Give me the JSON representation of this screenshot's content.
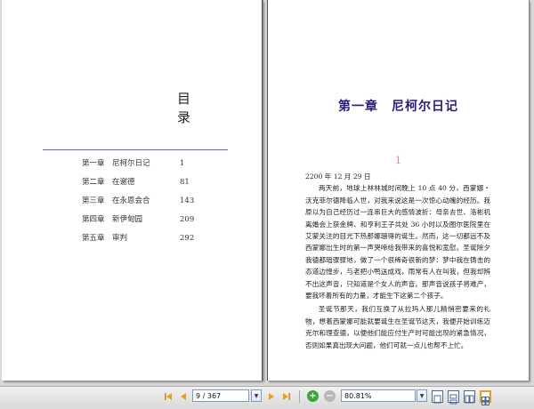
{
  "toc": {
    "title": "目 录",
    "items": [
      {
        "chapter": "第一章",
        "name": "尼柯尔日记",
        "page": "1"
      },
      {
        "chapter": "第二章",
        "name": "在谢德",
        "page": "81"
      },
      {
        "chapter": "第三章",
        "name": "在永恩会合",
        "page": "143"
      },
      {
        "chapter": "第四章",
        "name": "新伊甸园",
        "page": "209"
      },
      {
        "chapter": "第五章",
        "name": "审判",
        "page": "292"
      }
    ]
  },
  "chapter": {
    "heading": "第一章　尼柯尔日记",
    "number": "1",
    "date": "2200 年 12 月 29 日",
    "paragraphs": [
      "两天前，地球上林林城时间晚上 10 点 40 分，西蒙娜・沃克菲尔德降临人世，对我来说这是一次惊心动魄的经历。我原以为自己经历过一连串巨大的感情波折：母亲去世、洛彬机离婚会上获金牌、和亨利王子共处 36 小时以及图尔医院里在艾蒙关注的目光下热那娜珊得的诞生。然而，这一切都远不及西蒙娜出生时的第一声哭啼给我带来的喜悦和宽慰。圣诞除夕我德都暗骤骤地，做了一个很稀奇很新的梦：梦中我在铸击的态道边惶步，与老把小鸭送成戏，雨常有人在叫我，但我却辨不出这声音，只知道是个女人的声音。那声音说孩子将难产，要我坏着所有的力量，才能生下这第二个孩子。",
      "圣诞节那天，我们互换了从拉玛人那儿精悄密要来的礼物，想着西蒙娜可能就要诞生在圣诞节这天，我便开始训练迈克尔和理查德，以便他们能应付生产时可能出现的紧急情况，否则如果真出现大问题，他们可就一点儿也帮不上忙。"
    ]
  },
  "toolbar": {
    "page_value": "9 / 367",
    "zoom_value": "80.81%"
  }
}
